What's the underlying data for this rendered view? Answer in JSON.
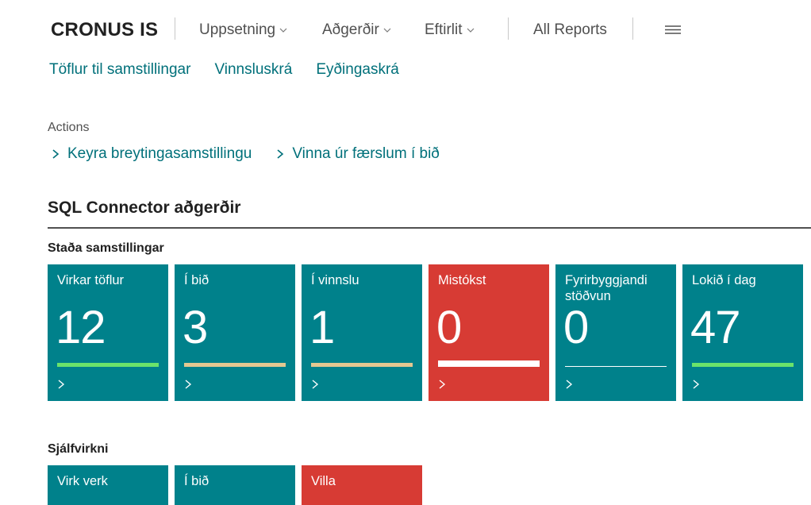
{
  "header": {
    "company": "CRONUS IS",
    "menu": [
      {
        "label": "Uppsetning",
        "has_dropdown": true
      },
      {
        "label": "Aðgerðir",
        "has_dropdown": true
      },
      {
        "label": "Eftirlit",
        "has_dropdown": true
      }
    ],
    "all_reports": "All Reports",
    "hamburger_icon": "hamburger-icon"
  },
  "sublinks": [
    "Töflur til samstillingar",
    "Vinnsluskrá",
    "Eyðingaskrá"
  ],
  "actions": {
    "label": "Actions",
    "items": [
      "Keyra breytingasamstillingu",
      "Vinna úr færslum í bið"
    ]
  },
  "section": {
    "title": "SQL Connector aðgerðir"
  },
  "groups": [
    {
      "label": "Staða samstillingar",
      "tiles": [
        {
          "label": "Virkar töflur",
          "value": "12",
          "color": "#00818b",
          "bar_color": "#6be36b"
        },
        {
          "label": "Í bið",
          "value": "3",
          "color": "#00818b",
          "bar_color": "#e3c891"
        },
        {
          "label": "Í vinnslu",
          "value": "1",
          "color": "#00818b",
          "bar_color": "#e3c891"
        },
        {
          "label": "Mistókst",
          "value": "0",
          "color": "#d73b34",
          "bar_color": "#ffffff"
        },
        {
          "label": "Fyrirbyggjandi stöðvun",
          "value": "0",
          "color": "#00818b",
          "bar_color": "#ffffff"
        },
        {
          "label": "Lokið í dag",
          "value": "47",
          "color": "#00818b",
          "bar_color": "#6be36b"
        }
      ]
    },
    {
      "label": "Sjálfvirkni",
      "tiles": [
        {
          "label": "Virk verk",
          "color": "#00818b"
        },
        {
          "label": "Í bið",
          "color": "#00818b"
        },
        {
          "label": "Villa",
          "color": "#d73b34"
        }
      ]
    }
  ]
}
